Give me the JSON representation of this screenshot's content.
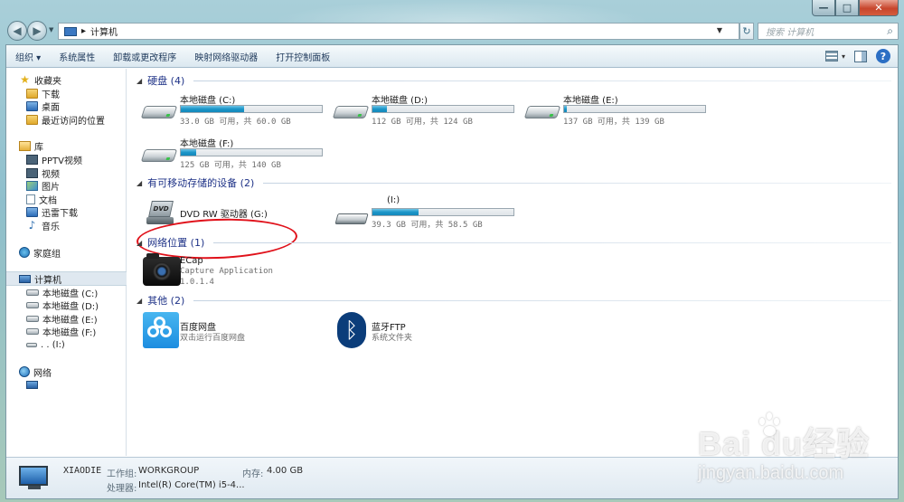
{
  "window": {
    "caption": {
      "minimize": "—",
      "maximize": "□",
      "close": "✕"
    },
    "nav": {
      "back": "◀",
      "forward": "▶",
      "refresh": "↻"
    },
    "address": {
      "separator": "▸",
      "location": "计算机"
    },
    "search": {
      "placeholder": "搜索 计算机"
    }
  },
  "toolbar": {
    "items": [
      "组织 ▾",
      "系统属性",
      "卸载或更改程序",
      "映射网络驱动器",
      "打开控制面板"
    ],
    "views_dropdown": "▾",
    "help": "?"
  },
  "nav_pane": {
    "favorites": {
      "label": "收藏夹",
      "items": [
        "下载",
        "桌面",
        "最近访问的位置"
      ]
    },
    "libraries": {
      "label": "库",
      "items": [
        "PPTV视频",
        "视频",
        "图片",
        "文档",
        "迅雷下载",
        "音乐"
      ]
    },
    "homegroup": {
      "label": "家庭组"
    },
    "computer": {
      "label": "计算机",
      "items": [
        "本地磁盘 (C:)",
        "本地磁盘 (D:)",
        "本地磁盘 (E:)",
        "本地磁盘 (F:)",
        ". . (I:)"
      ]
    },
    "network": {
      "label": "网络"
    }
  },
  "content": {
    "groups": {
      "hard_disks": "硬盘 (4)",
      "removable": "有可移动存储的设备 (2)",
      "network": "网络位置 (1)",
      "other": "其他 (2)"
    },
    "drives": [
      {
        "name": "本地磁盘 (C:)",
        "info": "33.0 GB 可用，共 60.0 GB",
        "used_fraction": 0.45
      },
      {
        "name": "本地磁盘 (D:)",
        "info": "112 GB 可用，共 124 GB",
        "used_fraction": 0.1
      },
      {
        "name": "本地磁盘 (E:)",
        "info": "137 GB 可用，共 139 GB",
        "used_fraction": 0.02
      },
      {
        "name": "本地磁盘 (F:)",
        "info": "125 GB 可用，共 140 GB",
        "used_fraction": 0.11
      }
    ],
    "removable": {
      "dvd": {
        "name": "DVD RW 驱动器 (G:)",
        "icon_text": "DVD"
      },
      "usb": {
        "name": "(I:)",
        "info": "39.3 GB 可用，共 58.5 GB",
        "used_fraction": 0.33
      }
    },
    "network_items": [
      {
        "name": "ECap",
        "line2": "Capture Application",
        "line3": "1.0.1.4"
      }
    ],
    "other_items": [
      {
        "name": "百度网盘",
        "desc": "双击运行百度网盘",
        "icon": "baidu-netdisk-icon"
      },
      {
        "name": "蓝牙FTP",
        "desc": "系统文件夹",
        "icon": "bluetooth-icon"
      }
    ]
  },
  "details": {
    "computer_name": "XIAODIE",
    "workgroup_label": "工作组:",
    "workgroup": "WORKGROUP",
    "memory_label": "内存:",
    "memory": "4.00 GB",
    "cpu_label": "处理器:",
    "cpu": "Intel(R) Core(TM) i5-4..."
  },
  "watermark": {
    "logo": "Bai  du经验",
    "url": "jingyan.baidu.com"
  },
  "colors": {
    "accent": "#1e3287",
    "bar_fill": "#1b95c8",
    "annotation": "#e0111a"
  }
}
